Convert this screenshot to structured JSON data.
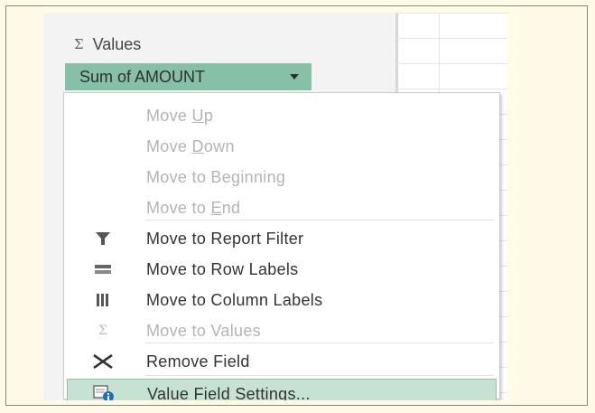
{
  "values_area": {
    "sigma_glyph": "Σ",
    "header_label": "Values",
    "field_label": "Sum of AMOUNT"
  },
  "menu": {
    "items": [
      {
        "label": "Move Up",
        "pre": "Move ",
        "mnemonic": "U",
        "post": "p",
        "enabled": false,
        "icon": "none"
      },
      {
        "label": "Move Down",
        "pre": "Move ",
        "mnemonic": "D",
        "post": "own",
        "enabled": false,
        "icon": "none"
      },
      {
        "label": "Move to Beginning",
        "pre": "Move to Be",
        "mnemonic": "g",
        "post": "inning",
        "enabled": false,
        "icon": "none"
      },
      {
        "label": "Move to End",
        "pre": "Move to ",
        "mnemonic": "E",
        "post": "nd",
        "enabled": false,
        "icon": "none"
      },
      {
        "label": "Move to Report Filter",
        "pre": "Move to Report Filter",
        "mnemonic": "",
        "post": "",
        "enabled": true,
        "icon": "filter-icon"
      },
      {
        "label": "Move to Row Labels",
        "pre": "Move to Row Labels",
        "mnemonic": "",
        "post": "",
        "enabled": true,
        "icon": "rows-icon"
      },
      {
        "label": "Move to Column Labels",
        "pre": "Move to Column Labels",
        "mnemonic": "",
        "post": "",
        "enabled": true,
        "icon": "columns-icon"
      },
      {
        "label": "Move to Values",
        "pre": "Move to Values",
        "mnemonic": "",
        "post": "",
        "enabled": false,
        "icon": "sigma-icon"
      },
      {
        "label": "Remove Field",
        "pre": "Remove Field",
        "mnemonic": "",
        "post": "",
        "enabled": true,
        "icon": "remove-icon"
      },
      {
        "label": "Value Field Settings...",
        "pre": "Value Field Setti",
        "mnemonic": "n",
        "post": "gs...",
        "enabled": true,
        "icon": "settings-icon",
        "selected": true
      }
    ]
  },
  "colors": {
    "field_pill": "#86c0a6",
    "selected_item": "#c6e2d3",
    "page_background": "#fffbe6"
  }
}
